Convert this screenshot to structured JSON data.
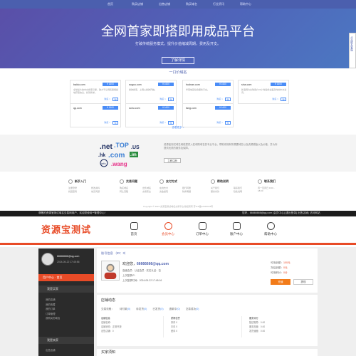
{
  "top_nav": [
    "首页",
    "购买店铺",
    "出售店铺",
    "购买域名",
    "行业资讯",
    "帮助中心"
  ],
  "hero": {
    "title": "全网首家即搭即用成品平台",
    "subtitle": "打破传统服务模式，提升价值缩减周期，费用及开支。",
    "button": "了解详情"
  },
  "side_widget": "点击联系客服",
  "domains": {
    "title": "一口价域名",
    "more": "查看更多 >",
    "items": [
      {
        "name": "baidu.com",
        "price": "¥ 1600",
        "desc": "全球最大的中文搜索引擎，致力于让网民更便捷地获取信息，找到所求。",
        "link": "购买 >",
        "cart": "购"
      },
      {
        "name": "sogou.com",
        "price": "¥ 1600",
        "desc": "搜狗搜索，上网从搜狗开始。",
        "link": "购买 >",
        "cart": "购"
      },
      {
        "name": "hudnan.com",
        "price": "¥ 1600",
        "desc": "华南地区综合服务平台。",
        "link": "购买 >",
        "cart": "购"
      },
      {
        "name": "sina.com",
        "price": "¥ 1600",
        "desc": "新浪网为全球用户24小时提供全面及时的中文资讯。",
        "link": "购买 >",
        "cart": "购"
      },
      {
        "name": "qq.com",
        "price": "¥ 1600",
        "desc": "",
        "link": "购买 >",
        "cart": "购"
      },
      {
        "name": "sohu.com",
        "price": "¥ 1600",
        "desc": "",
        "link": "购买 >",
        "cart": "购"
      },
      {
        "name": "fang.com",
        "price": "¥ 1600",
        "desc": "",
        "link": "购买 >",
        "cart": "购"
      }
    ]
  },
  "brand": {
    "logo_words": [
      ".net",
      ".TOP",
      ".US",
      ".hk",
      ".com",
      ".im",
      ".info",
      ".wang"
    ],
    "text": "资源宝测试域名网络提供入驻和购域名的专业平台，帮助你拥有所需要域名以及资源模板以及价格，并为你提供优质的服务及保障。",
    "button": "立即注册"
  },
  "footer": {
    "cols": [
      {
        "head": "新手入门",
        "items": [
          "注册登录",
          "修改资料",
          "找回密码",
          "常见问题"
        ]
      },
      {
        "head": "交易问题",
        "items": [
          "购买域名",
          "出售域名",
          "转让流程",
          "交易安全"
        ]
      },
      {
        "head": "支付方式",
        "items": [
          "在线支付",
          "银行转账",
          "资金提现",
          "财务明细"
        ]
      },
      {
        "head": "帮助说明",
        "items": [
          "关于我们",
          "联系我们",
          "服务条款",
          "隐私说明"
        ]
      },
      {
        "head": "联系我们",
        "items": [
          "周一至周日 9:00 - 18:00"
        ]
      }
    ],
    "copyright": "Copyright © 2024 资源宝测试域名交易平台 版权所有 苏ICP备12345678号"
  },
  "black_bar": {
    "left": "尊敬的资源宝测试域名交易网用户，欢迎您使用**管理中心！",
    "right": "您好，66666666@qq.com [会员中心] [退出登录]   出售店铺 | 访问网站"
  },
  "site": {
    "logo": "资源宝测试",
    "nav": [
      "首页",
      "会员中心",
      "订单中心",
      "账户中心",
      "帮助中心"
    ]
  },
  "sidebar": {
    "email": "66666666@qq.com",
    "time": "2024-05-22 17:45:56",
    "center": "用户中心 · 首页",
    "sections": [
      {
        "title": "我是买家",
        "items": [
          "我的店铺",
          "我的收藏",
          "我的订单",
          "订单管理",
          "我购买的域名"
        ]
      },
      {
        "title": "我是卖家",
        "items": [
          "出售店铺"
        ]
      }
    ]
  },
  "account": {
    "title": "账号信息  （ID：3）",
    "welcome_prefix": "欢迎您，",
    "welcome_email": "66666666@qq.com",
    "level": "高级会员：认证会员  ·  实名认证：否",
    "login_ip": "上次登录IP：",
    "login_time": "上次登录时间：2024-05-22 17:45:16",
    "balance_label": "可用余额：",
    "balance": "100元",
    "frozen_label": "冻结余额：",
    "frozen": "0元",
    "points_label": "可用积分：",
    "points": "0分",
    "recharge": "充值",
    "withdraw": "提现"
  },
  "shop": {
    "title": "店铺动态",
    "tabs": [
      {
        "label": "交易流程：",
        "num": ""
      },
      {
        "label": "待付款",
        "num": "(0)"
      },
      {
        "label": "待发货",
        "num": "(0)"
      },
      {
        "label": "已发货",
        "num": "(0)"
      },
      {
        "label": "退款中",
        "num": "(0)"
      },
      {
        "label": "交易成功",
        "num": "(0)"
      }
    ],
    "box1": [
      "店铺信息",
      "店铺名称：",
      "店铺状态：正常开放",
      "出售店铺：0"
    ],
    "box2": [
      "获得信誉",
      "好评 0",
      "中评 0",
      "差评 0"
    ],
    "box3": [
      "服务评分",
      "描述相符：0.00",
      "服务态度：0.00",
      "发货速度：0.00"
    ]
  },
  "buy": {
    "title": "买家须知"
  }
}
